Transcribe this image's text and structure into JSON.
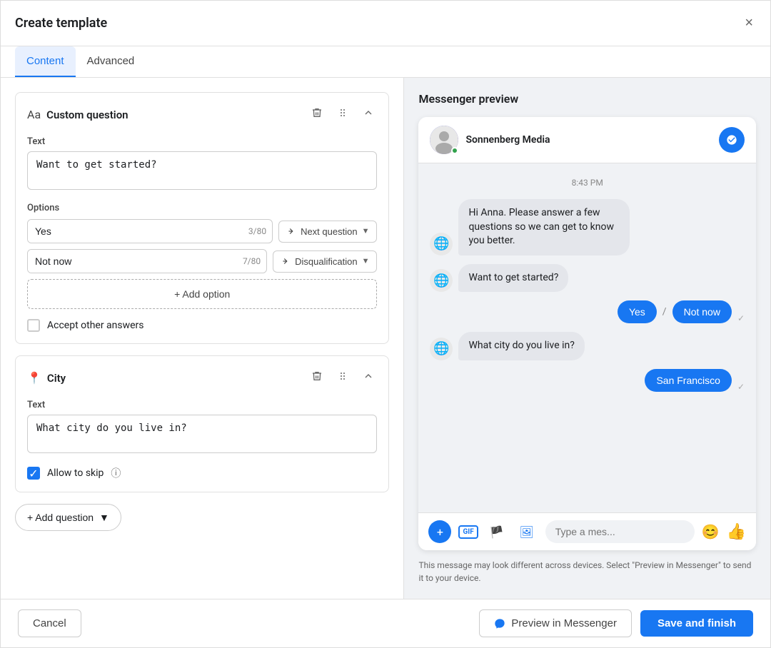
{
  "modal": {
    "title": "Create template",
    "close_label": "×"
  },
  "tabs": {
    "content_label": "Content",
    "advanced_label": "Advanced"
  },
  "custom_question": {
    "title": "Custom question",
    "icon": "Aa",
    "field_label": "Text",
    "question_text": "Want to get started?",
    "options_label": "Options",
    "options": [
      {
        "text": "Yes",
        "count": "3/80",
        "action": "Next question"
      },
      {
        "text": "Not now",
        "count": "7/80",
        "action": "Disqualification"
      }
    ],
    "add_option_label": "+ Add option",
    "accept_label": "Accept other answers"
  },
  "city_question": {
    "title": "City",
    "field_label": "Text",
    "question_text": "What city do you live in?",
    "allow_skip_label": "Allow to skip",
    "info_icon": "ℹ"
  },
  "add_question": {
    "label": "+ Add question"
  },
  "messenger_preview": {
    "title": "Messenger preview",
    "profile_name": "Sonnenberg Media",
    "timestamp": "8:43 PM",
    "intro_message": "Hi Anna. Please answer a few questions so we can get to know you better.",
    "q1": "Want to get started?",
    "q1_yes": "Yes",
    "q1_notnow": "Not now",
    "q2": "What city do you live in?",
    "q2_answer": "San Francisco",
    "input_placeholder": "Type a mes...",
    "note": "This message may look different across devices. Select \"Preview in Messenger\" to send it to your device."
  },
  "footer": {
    "cancel_label": "Cancel",
    "preview_label": "Preview in Messenger",
    "save_label": "Save and finish"
  }
}
